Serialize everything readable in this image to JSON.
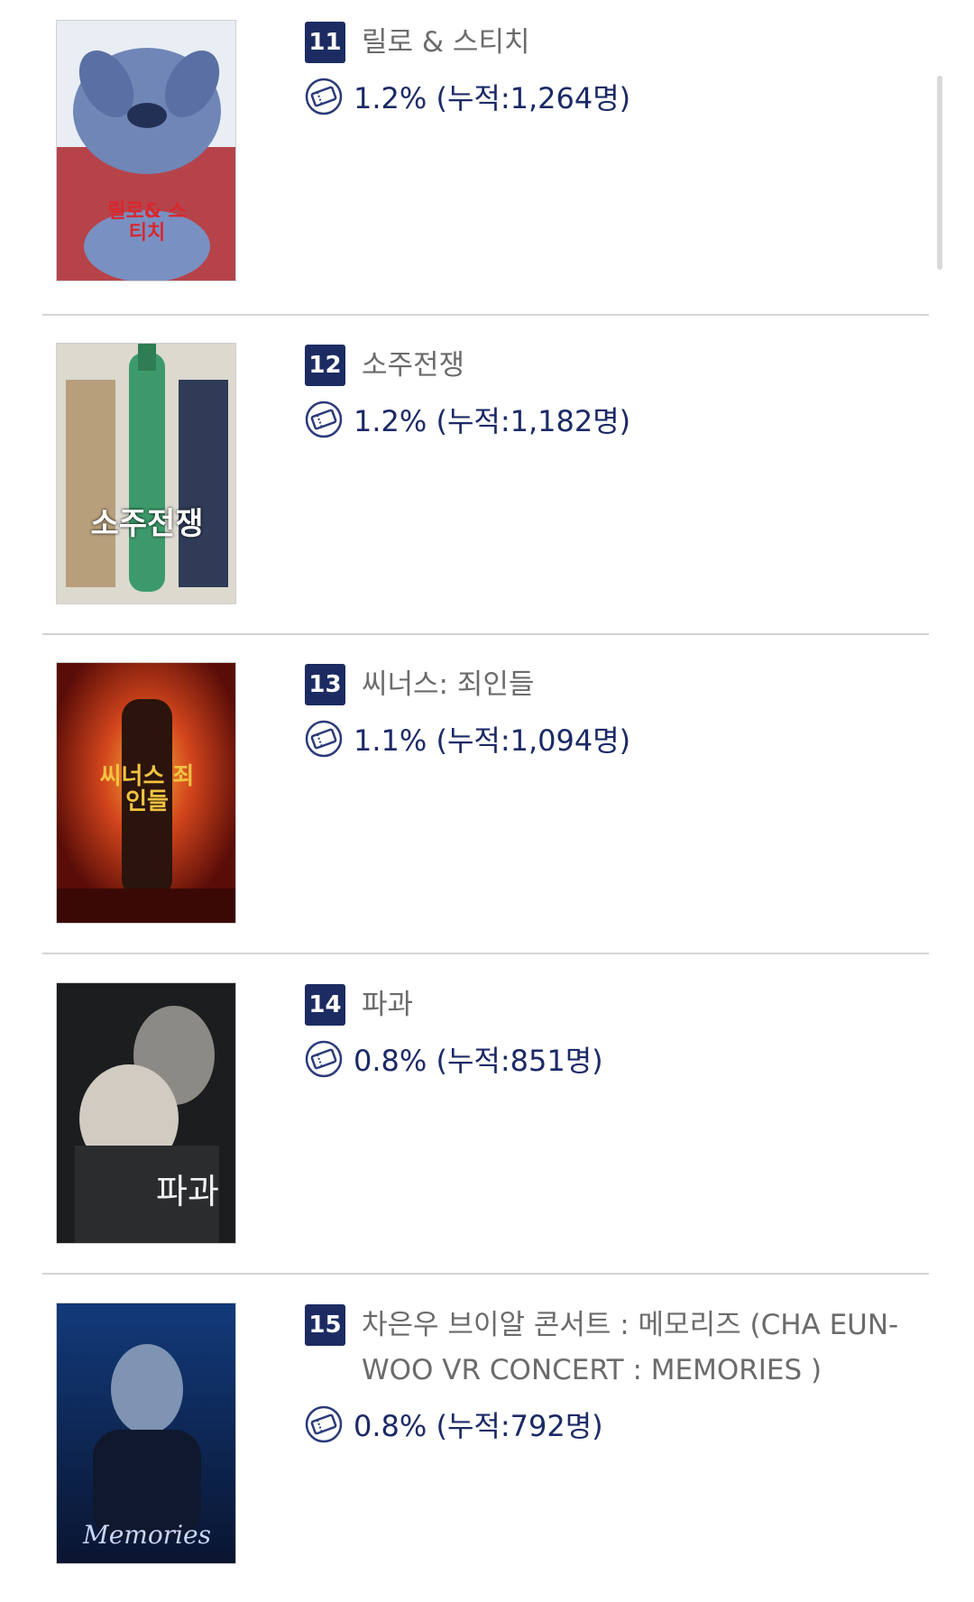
{
  "movies": [
    {
      "rank": "11",
      "title": "릴로 & 스티치",
      "share": "1.2% (누적:1,264명)",
      "poster_text": "릴로& 스티치"
    },
    {
      "rank": "12",
      "title": "소주전쟁",
      "share": "1.2% (누적:1,182명)",
      "poster_text": "소주전쟁"
    },
    {
      "rank": "13",
      "title": "씨너스: 죄인들",
      "share": "1.1% (누적:1,094명)",
      "poster_text": "씨너스 죄인들"
    },
    {
      "rank": "14",
      "title": "파과",
      "share": "0.8% (누적:851명)",
      "poster_text": "파과"
    },
    {
      "rank": "15",
      "title": "차은우 브이알 콘서트 : 메모리즈 (CHA EUN-WOO VR CONCERT : MEMORIES )",
      "share": "0.8% (누적:792명)",
      "poster_text": "Memories"
    }
  ],
  "icons": {
    "ticket": "ticket-icon"
  },
  "colors": {
    "rank_badge": "#1c2c62",
    "share_text": "#1b2a66",
    "title_text": "#6b6b6b"
  }
}
